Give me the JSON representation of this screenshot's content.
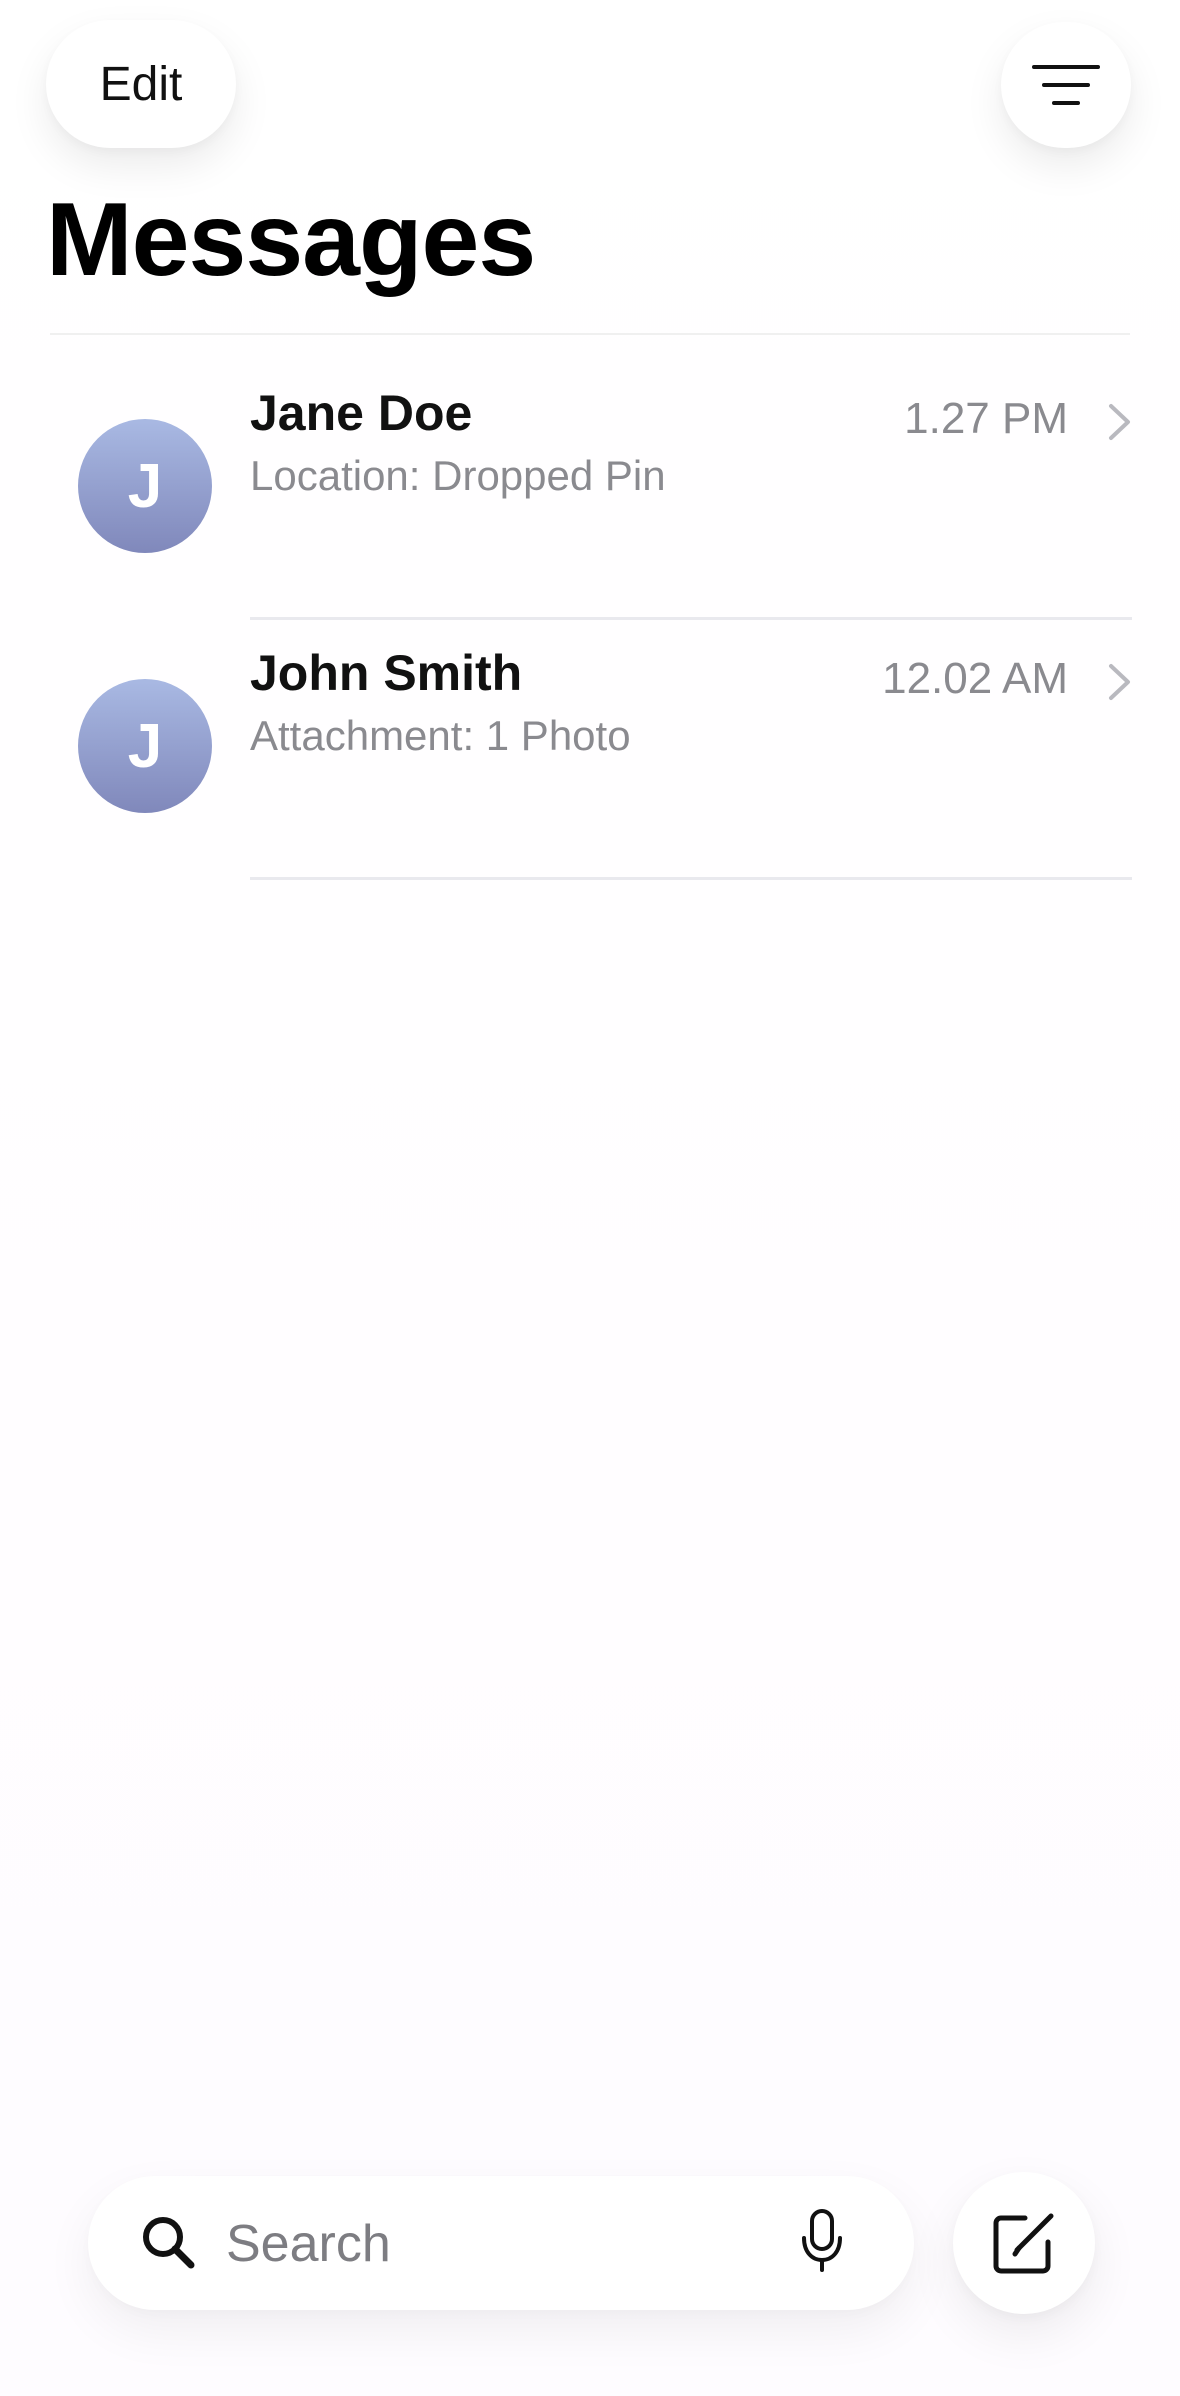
{
  "header": {
    "edit_label": "Edit",
    "filter_icon": "filter-lines-icon",
    "title": "Messages"
  },
  "conversations": [
    {
      "initial": "J",
      "name": "Jane Doe",
      "preview": "Location: Dropped Pin",
      "time": "1.27 PM"
    },
    {
      "initial": "J",
      "name": "John Smith",
      "preview": "Attachment: 1 Photo",
      "time": "12.02 AM"
    }
  ],
  "search": {
    "placeholder": "Search",
    "search_icon": "search-icon",
    "mic_icon": "microphone-icon"
  },
  "compose": {
    "icon": "compose-icon"
  },
  "colors": {
    "avatar_top": "#a9b9e3",
    "avatar_bottom": "#8088bb",
    "secondary_text": "#8a8a8f",
    "separator": "#e9e9ee"
  }
}
